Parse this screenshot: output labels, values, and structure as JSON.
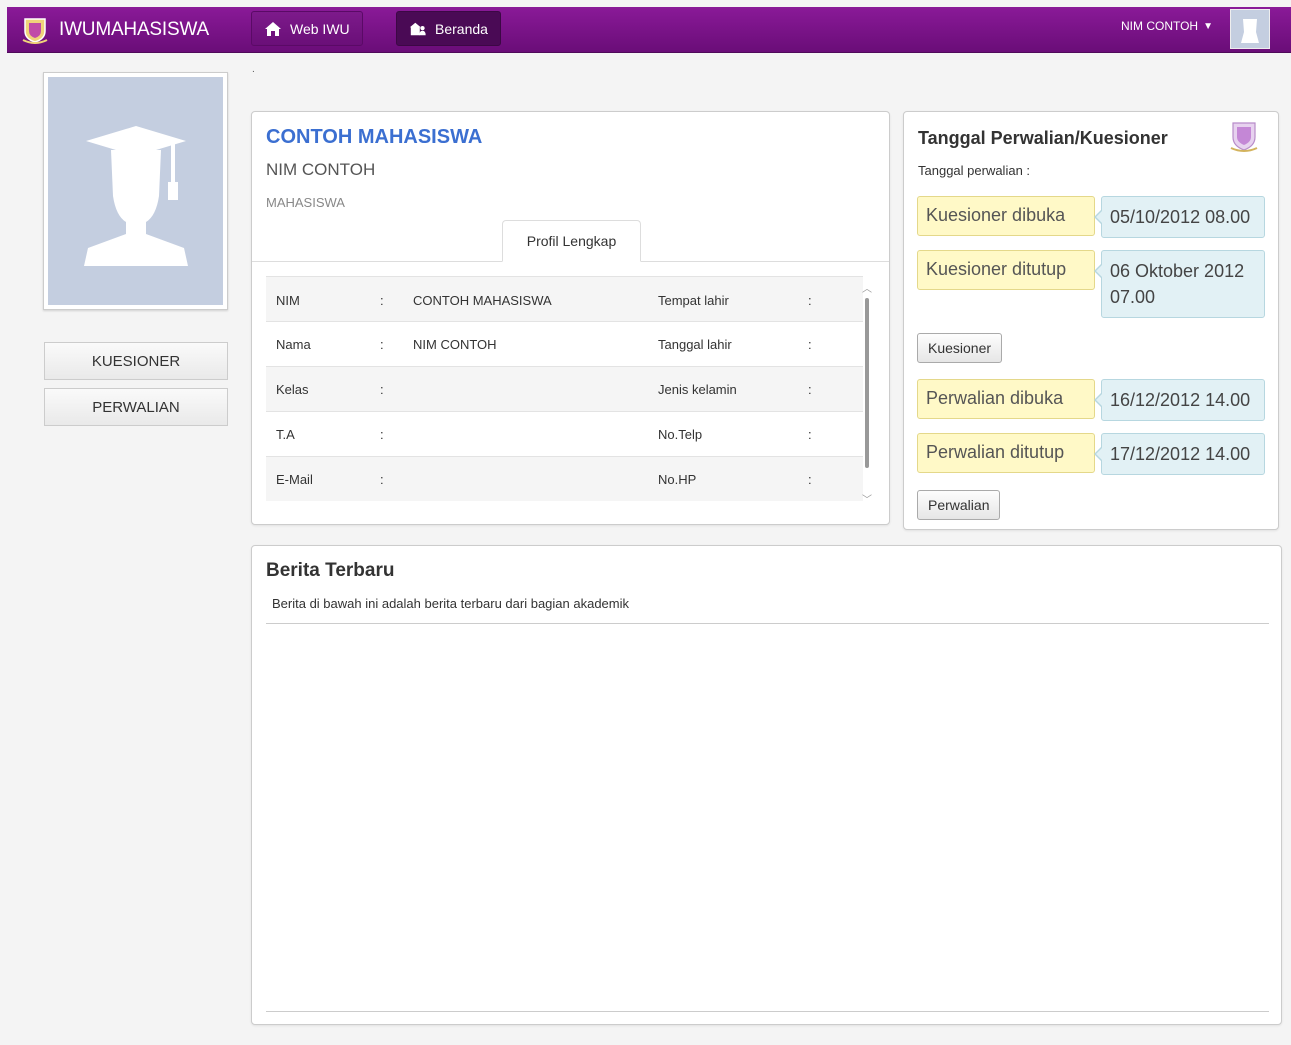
{
  "header": {
    "brand": "IWUMAHASISWA",
    "nav": [
      {
        "label": "Web IWU",
        "icon": "home-icon"
      },
      {
        "label": "Beranda",
        "icon": "home-users-icon"
      }
    ],
    "user": "NIM CONTOH",
    "user_caret": "▼",
    "colors": {
      "bar": "#7b128b",
      "active": "#4a0a55"
    }
  },
  "sidebar": {
    "buttons": [
      {
        "label": "KUESIONER"
      },
      {
        "label": "PERWALIAN"
      }
    ],
    "dot": "."
  },
  "profile": {
    "name": "CONTOH MAHASISWA",
    "nim": "NIM CONTOH",
    "role": "MAHASISWA",
    "tab": "Profil Lengkap",
    "rows": [
      {
        "label": "NIM",
        "sep": ":",
        "value": "CONTOH MAHASISWA",
        "label2": "Tempat lahir",
        "sep2": ":",
        "value2": ""
      },
      {
        "label": "Nama",
        "sep": ":",
        "value": "NIM CONTOH",
        "label2": "Tanggal lahir",
        "sep2": ":",
        "value2": ""
      },
      {
        "label": "Kelas",
        "sep": ":",
        "value": "",
        "label2": "Jenis kelamin",
        "sep2": ":",
        "value2": ""
      },
      {
        "label": "T.A",
        "sep": ":",
        "value": "",
        "label2": "No.Telp",
        "sep2": ":",
        "value2": ""
      },
      {
        "label": "E-Mail",
        "sep": ":",
        "value": "",
        "label2": "No.HP",
        "sep2": ":",
        "value2": ""
      }
    ],
    "scroll_up": "︿",
    "scroll_down": "﹀"
  },
  "dates": {
    "title": "Tanggal Perwalian/Kuesioner",
    "subtitle": "Tanggal perwalian :",
    "kuesioner_open_label": "Kuesioner dibuka",
    "kuesioner_open_value": "05/10/2012 08.00",
    "kuesioner_close_label": "Kuesioner ditutup",
    "kuesioner_close_value": "06 Oktober 2012 07.00",
    "kuesioner_button": "Kuesioner",
    "perwalian_open_label": "Perwalian dibuka",
    "perwalian_open_value": "16/12/2012 14.00",
    "perwalian_close_label": "Perwalian ditutup",
    "perwalian_close_value": "17/12/2012 14.00",
    "perwalian_button": "Perwalian"
  },
  "news": {
    "title": "Berita Terbaru",
    "subtitle": "Berita di bawah ini adalah berita terbaru dari bagian akademik"
  }
}
